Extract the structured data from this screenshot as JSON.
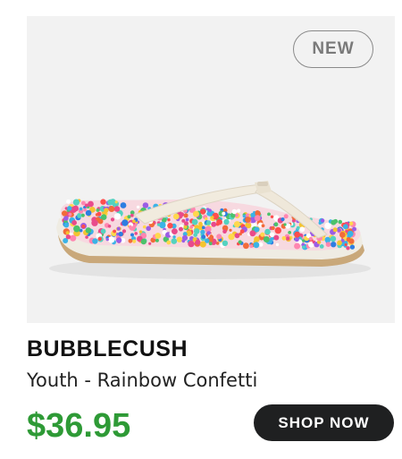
{
  "product": {
    "badge": "NEW",
    "name": "BUBBLECUSH",
    "variant": "Youth - Rainbow Confetti",
    "price": "$36.95",
    "cta_label": "SHOP NOW",
    "image_description": "white flip-flop sandal with rainbow confetti footbed"
  },
  "colors": {
    "price": "#2e9a36",
    "button_bg": "#1f2021",
    "image_bg": "#f2f2f2"
  }
}
